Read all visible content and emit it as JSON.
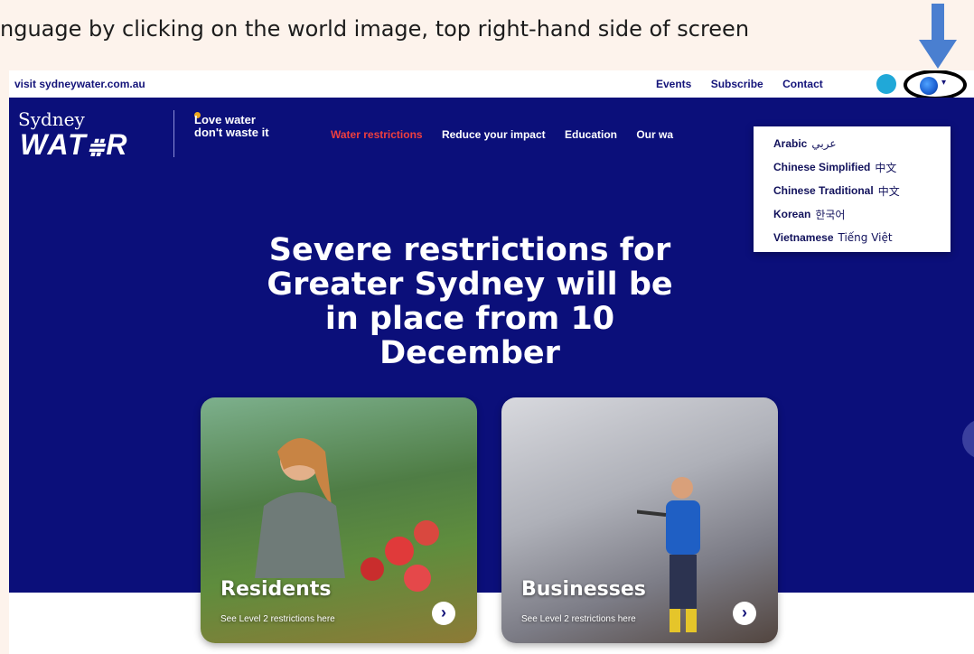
{
  "instruction": "nguage by clicking on the world image, top right-hand side of screen",
  "utility": {
    "visit": "visit sydneywater.com.au",
    "links": [
      "Events",
      "Subscribe",
      "Contact"
    ]
  },
  "brand": {
    "name_top": "Sydney",
    "name_bottom": "WAT⩷R",
    "tagline_1": "Love water",
    "tagline_2": "don't waste it"
  },
  "nav": {
    "items": [
      "Water restrictions",
      "Reduce your impact",
      "Education",
      "Our wa"
    ],
    "active_index": 0
  },
  "language_menu": {
    "items": [
      {
        "label": "Arabic",
        "native": "عربي"
      },
      {
        "label": "Chinese Simplified",
        "native": "中文"
      },
      {
        "label": "Chinese Traditional",
        "native": "中文"
      },
      {
        "label": "Korean",
        "native": "한국어"
      },
      {
        "label": "Vietnamese",
        "native": "Tiếng Việt"
      }
    ]
  },
  "headline": {
    "lines": [
      "Severe restrictions for",
      "Greater Sydney will be",
      "in place from 10",
      "December"
    ]
  },
  "cards": [
    {
      "title": "Residents",
      "subtitle": "See Level 2 restrictions here"
    },
    {
      "title": "Businesses",
      "subtitle": "See Level 2 restrictions here"
    }
  ],
  "colors": {
    "navy": "#0b0f7a",
    "accent_red": "#ef3f3f",
    "arrow_blue": "#4a7fd0"
  }
}
